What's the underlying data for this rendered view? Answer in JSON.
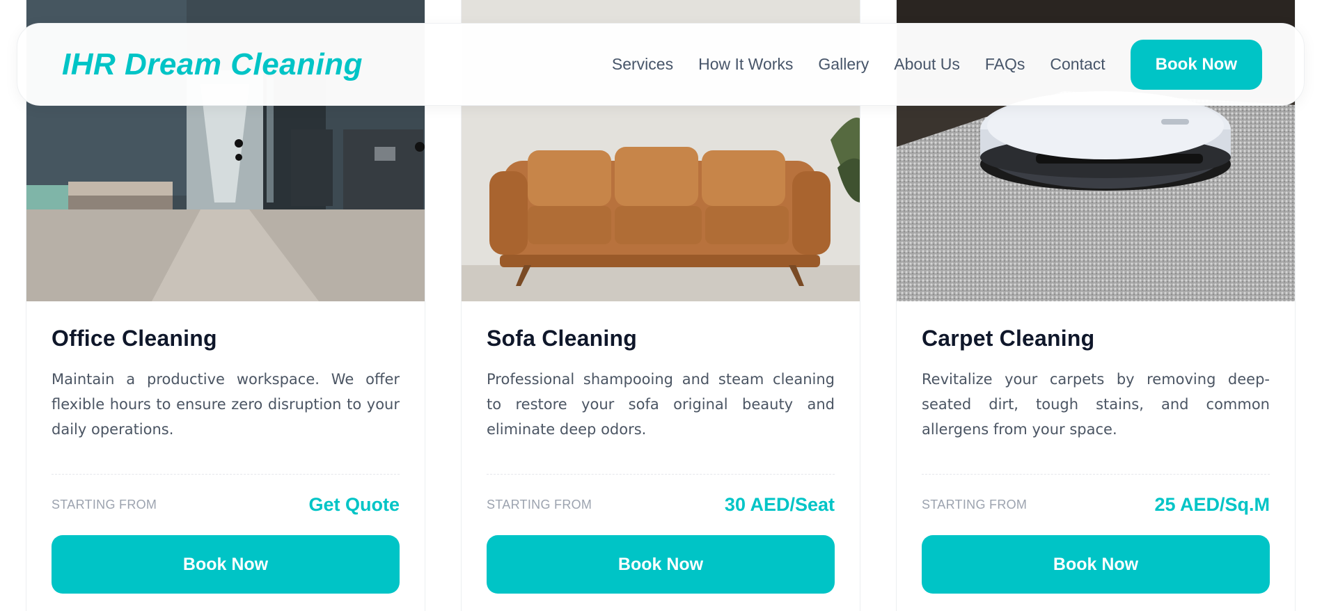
{
  "header": {
    "logo": "IHR Dream Cleaning",
    "nav": [
      "Services",
      "How It Works",
      "Gallery",
      "About Us",
      "FAQs",
      "Contact"
    ],
    "cta": "Book Now"
  },
  "cards": [
    {
      "image": "office-interior-image",
      "title": "Office Cleaning",
      "description": "Maintain a productive workspace. We offer flexible hours to ensure zero disruption to your daily operations.",
      "price_label": "STARTING FROM",
      "price": "Get Quote",
      "button": "Book Now"
    },
    {
      "image": "leather-sofa-image",
      "title": "Sofa Cleaning",
      "description": "Professional shampooing and steam cleaning to restore your sofa original beauty and eliminate deep odors.",
      "price_label": "STARTING FROM",
      "price": "30 AED/Seat",
      "button": "Book Now"
    },
    {
      "image": "robot-vacuum-carpet-image",
      "title": "Carpet Cleaning",
      "description": "Revitalize your carpets by removing deep-seated dirt, tough stains, and common allergens from your space.",
      "price_label": "STARTING FROM",
      "price": "25 AED/Sq.M",
      "button": "Book Now"
    }
  ],
  "colors": {
    "accent": "#00c4c6",
    "heading": "#0f172a",
    "body_text": "#4b5563",
    "muted": "#9ca3af"
  }
}
